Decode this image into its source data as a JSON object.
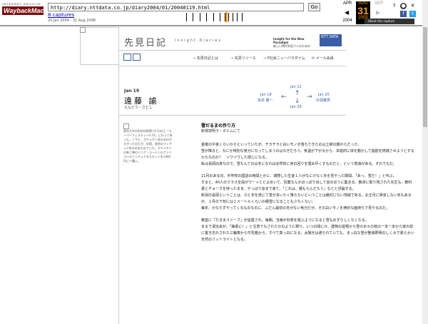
{
  "wayback": {
    "logo_top": "INTERNET ARCHIVE",
    "logo_main": "WaybackMachine",
    "url": "http://diary.nttdata.co.jp/diary2004/01/20040119.html",
    "go_label": "Go",
    "captures_label": "8 captures",
    "date_range": "20 Jan 2004 - 31 Aug 2008",
    "cal": {
      "prev_month": "APR",
      "cur_month": "AUG",
      "next_month": "SEP",
      "prev_year": "2004",
      "cur_day": "31",
      "cur_year": "2005",
      "next_year": "2008"
    },
    "about_label": "About this capture"
  },
  "site": {
    "title": "先見日記",
    "title_sub": "Insight Diaries",
    "np_line1": "Insight for the New Paradigm",
    "np_line2": "新しい時代を担う人のための",
    "ntt_label": "NTT DATA",
    "nav": [
      {
        "label": "先見日記とは"
      },
      {
        "label": "先見リソース"
      },
      {
        "label": "P社会ニューパラダイム"
      },
      {
        "label": "メール会員"
      }
    ]
  },
  "entry": {
    "date": "Jan 19",
    "author": "遠藤 諭",
    "author_kana": "えんどう・さとし",
    "prev_date": "Jan 12",
    "left_date": "Jan 18",
    "left_name": "坂本 龍一",
    "right_date": "Jan 20",
    "right_name": "片岡義男",
    "next_date": "Jan 26",
    "image_caption": "東京大学の科学技術館で行われた「スーパーフェスティバル31」に行って持った。ソフビ、ガチャポン系のおはがきがったのだが、米国、各所のフィギュア系のお店も出ていた。ガチャポンの新三弾のミニゲ・ユージンのファミコンのミニチュア＆カセットを1400円にて購入。",
    "article_title": "雪だるまの作り方",
    "article_subtitle": "新環境明ラ・ボエムにて",
    "paragraphs": [
      "金曜の午後くらいからといっていたが、チラチラと白いモノが落ちてきたのは土曜の朝からだった。\n雪が降ると、なにか特別な気分になってしまうのはなぜだろう。気温が下がるから、本能的に体を動かして脂肪を燃焼させようとするからなのか？　ソワソワした感じになる。\n私は長岡出身なので、雪なんてのは冬になれば必然的に身の回りを埋め尽くすものだと、という意識がある。それでもだ。",
      "11月のある日、中学校の国語の時間とかに、適際した生徒１人がなにげなく外を見やった瞬間、「あっ、雪だ！」と叫ぶ。\nすると、40人のクラス全員がワーッとどよめいて、授業なんかほっぽり出して窓のほうに集まる。教卓に取り残された先生も、教科書とチョークを持ったまま、やっぱり窓まで来て、「これは、積もらんだろう」などと評論する。\n新潟の長岡ということは、ひと冬を通じて雪が多いたく降らないということは絶対にない地域である。お正月に帰省しない年もあるが、１月の下旬には１メートルくらいの積雪になることも少なくない。\n毎年、かならずやってくるものなのに、ふだん最初の冬がない気分だが、その白いモノを神妙な面持ちで見やるのだ。",
      "教室に「だるまストーブ」が設置され、毎朝、当番が石炭を運ぶようになると雪もめずらしくなくなる。\nまるで湯治会が、「静粛に！」と注意でもされたかのように黙り、いつの間にか、建物の屋根から雪の木々の枝の一本一本から家の前に置き忘れされた三輪車から牛乳箱から、すべて真っ白になる。太陽光は遮られていても、まっ白な雪が聖域照明のしくみで柔らかい天然のフットライトとなる。"
    ]
  }
}
